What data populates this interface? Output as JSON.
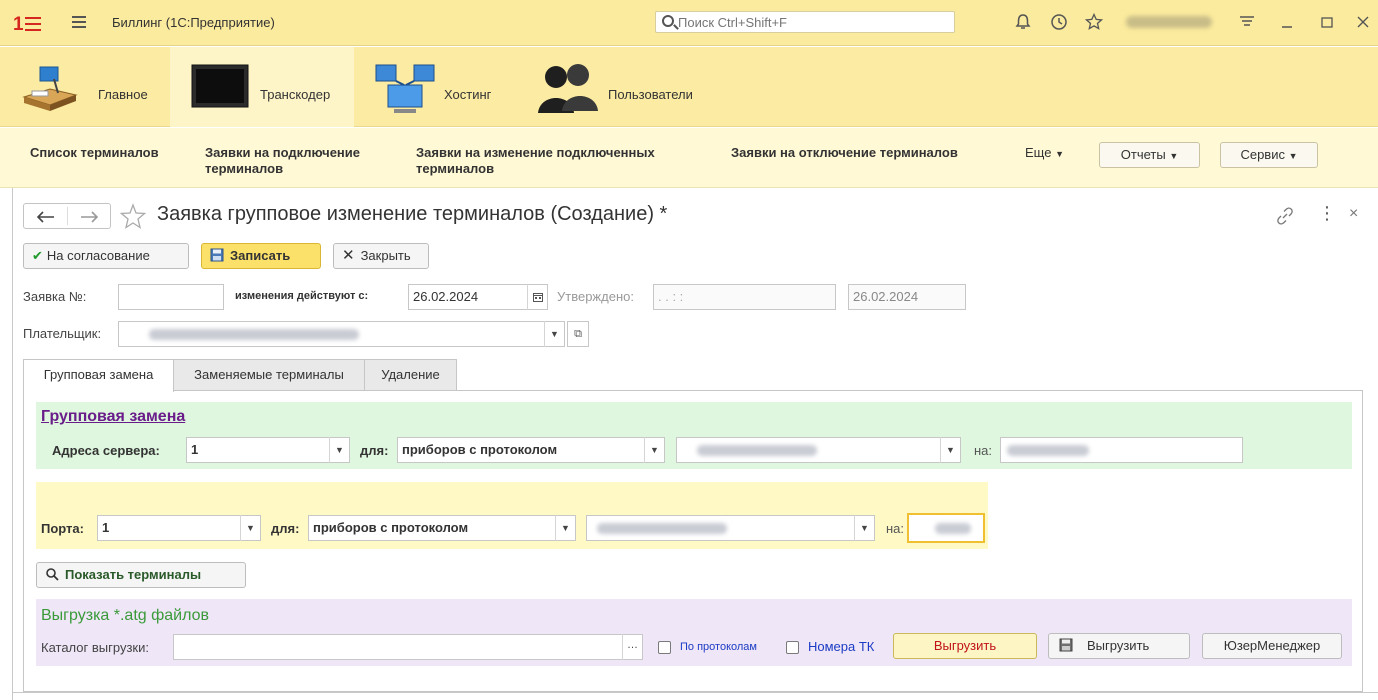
{
  "titlebar": {
    "app_title": "Биллинг  (1С:Предприятие)",
    "search_placeholder": "Поиск Ctrl+Shift+F"
  },
  "sections": [
    {
      "label": "Главное",
      "icon": "desk-lamp-icon"
    },
    {
      "label": "Транскодер",
      "icon": "monitor-icon"
    },
    {
      "label": "Хостинг",
      "icon": "network-computers-icon"
    },
    {
      "label": "Пользователи",
      "icon": "users-icon"
    }
  ],
  "nav": {
    "link1": "Список терминалов",
    "link2a": "Заявки на подключение",
    "link2b": "терминалов",
    "link3a": "Заявки на изменение подключенных",
    "link3b": "терминалов",
    "link4": "Заявки на отключение терминалов",
    "more": "Еще",
    "reports": "Отчеты",
    "service": "Сервис"
  },
  "form": {
    "title": "Заявка групповое изменение терминалов (Создание) *",
    "btn_approve": "На согласование",
    "btn_save": "Записать",
    "btn_close": "Закрыть",
    "label_number": "Заявка №:",
    "label_effective": "изменения действуют с:",
    "effective_date": "26.02.2024",
    "label_approved": "Утверждено:",
    "approved_value": ".  .       :  :",
    "date2": "26.02.2024",
    "label_payer": "Плательщик:"
  },
  "tabs": [
    "Групповая замена",
    "Заменяемые терминалы",
    "Удаление"
  ],
  "group_replace": {
    "header": "Групповая замена",
    "label_server": "Адреса сервера:",
    "server_value": "1",
    "label_for": "для:",
    "protocol_value": "приборов с протоколом",
    "label_to": "на:",
    "label_port": "Порта:",
    "port_value": "1",
    "port_protocol_value": "приборов с протоколом",
    "btn_show": "Показать терминалы"
  },
  "export": {
    "header": "Выгрузка *.atg файлов",
    "label_dir": "Каталог выгрузки:",
    "chk_protocols": "По протоколам",
    "chk_numbers": "Номера ТК",
    "btn_export1": "Выгрузить",
    "btn_export2": "Выгрузить",
    "btn_usermanager": "ЮзерМенеджер"
  }
}
